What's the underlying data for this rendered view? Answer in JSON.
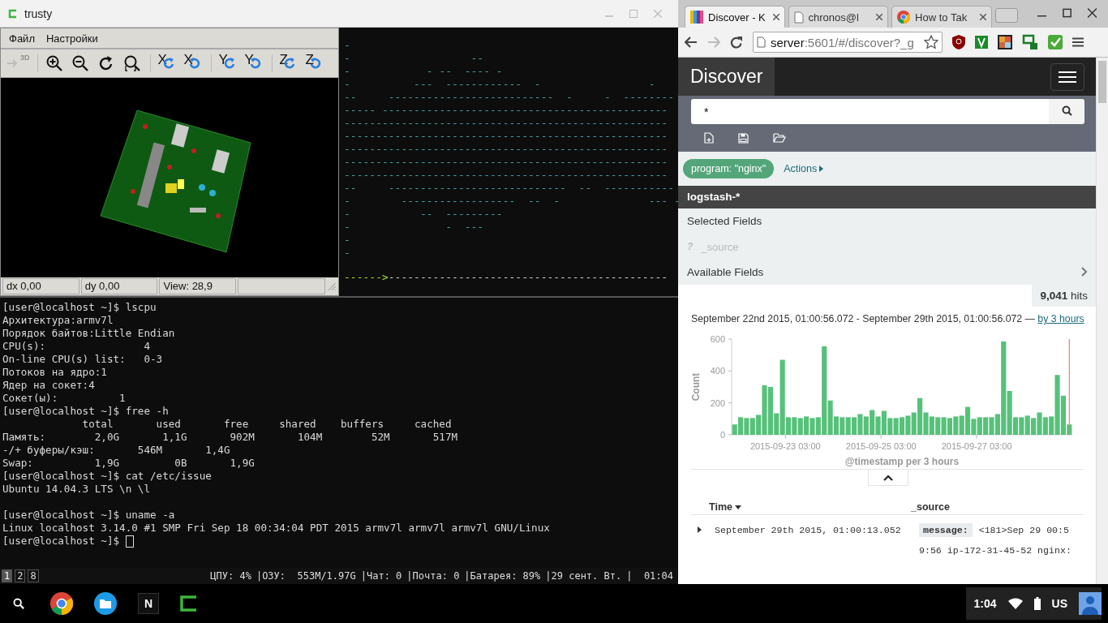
{
  "left_window": {
    "title": "trusty"
  },
  "app": {
    "menu": [
      "Файл",
      "Настройки"
    ],
    "toolbar": [
      {
        "kind": "perspective",
        "label": "3D",
        "disabled": true
      },
      {
        "kind": "zoomin",
        "disabled": false
      },
      {
        "kind": "zoomout",
        "disabled": false
      },
      {
        "kind": "redraw",
        "disabled": false
      },
      {
        "kind": "zoomfit",
        "disabled": false
      },
      {
        "kind": "rotateleft",
        "axis": "X",
        "disabled": false
      },
      {
        "kind": "rotateright",
        "axis": "X",
        "disabled": false
      },
      {
        "kind": "rotateleft",
        "axis": "Y",
        "disabled": false
      },
      {
        "kind": "rotateright",
        "axis": "Y",
        "disabled": false
      },
      {
        "kind": "rotateleft",
        "axis": "Z",
        "disabled": false
      },
      {
        "kind": "rotateright",
        "axis": "Z",
        "disabled": false
      }
    ],
    "status": [
      "dx 0,00",
      "dy 0,00",
      "View: 28,9"
    ]
  },
  "ascii": {
    "lines": [
      "-",
      "-                   --",
      "-            - --  ---- -",
      "-          ---  ------------  -                 -",
      "--     --------------------------  -     -  --------",
      "----- ---------------------------------------------",
      "---------------------------------------------------",
      "---------------------------------------------------",
      "---------------------------------------------------",
      "---------------------------------------------------",
      "---------------------------------------------------",
      "--     ----------------------------  --  -----------",
      "-        ------------------  --  -              --- -",
      "-           --  ---------",
      "-               -  ---",
      "-",
      "-"
    ],
    "progress": {
      "done": "------>",
      "rest": "--------------------------------------------"
    }
  },
  "terminal": {
    "lines": [
      {
        "kind": "text",
        "text": "[user@localhost ~]$ lscpu"
      },
      {
        "kind": "text",
        "text": "Архитектура:armv7l"
      },
      {
        "kind": "text",
        "text": "Порядок байтов:Little Endian"
      },
      {
        "kind": "text",
        "text": "CPU(s):                4"
      },
      {
        "kind": "text",
        "text": "On-line CPU(s) list:   0-3"
      },
      {
        "kind": "text",
        "text": "Потоков на ядро:1"
      },
      {
        "kind": "text",
        "text": "Ядер на сокет:4"
      },
      {
        "kind": "text",
        "text": "Сокет(ы):          1"
      },
      {
        "kind": "text",
        "text": "[user@localhost ~]$ free -h"
      },
      {
        "kind": "text",
        "text": "             total       used       free     shared    buffers     cached"
      },
      {
        "kind": "text",
        "text": "Память:        2,0G       1,1G       902M       104M        52M       517M"
      },
      {
        "kind": "text",
        "text": "-/+ буферы/кэш:       546M       1,4G"
      },
      {
        "kind": "text",
        "text": "Swap:          1,9G         0B       1,9G"
      },
      {
        "kind": "text",
        "text": "[user@localhost ~]$ cat /etc/issue"
      },
      {
        "kind": "text",
        "text": "Ubuntu 14.04.3 LTS \\n \\l"
      },
      {
        "kind": "blank"
      },
      {
        "kind": "text",
        "text": "[user@localhost ~]$ uname -a"
      },
      {
        "kind": "text",
        "text": "Linux localhost 3.14.0 #1 SMP Fri Sep 18 00:34:04 PDT 2015 armv7l armv7l armv7l GNU/Linux"
      }
    ],
    "prompt": "[user@localhost ~]$"
  },
  "tmux": {
    "windows": [
      {
        "label": "1",
        "selected": true
      },
      {
        "label": "2",
        "selected": false
      },
      {
        "label": "8",
        "selected": false
      }
    ],
    "segments": [
      "ЦПУ: 4%",
      "|ОЗУ:  553M/1.97G",
      "|Чат: 0",
      "|Почта: 0",
      "|Батарея: 89%",
      "|29 сент. Вт.",
      "|  01:04"
    ]
  },
  "browser": {
    "tabs": [
      {
        "title": "Discover - K",
        "kind": "kibana",
        "selected": true
      },
      {
        "title": "chronos@l",
        "kind": "page",
        "selected": false
      },
      {
        "title": "How to Tak",
        "kind": "chrome",
        "selected": false
      }
    ],
    "back_disabled": false,
    "forward_disabled": true,
    "url": {
      "host": "server",
      "rest": ":5601/#/discover?_g"
    },
    "extensions": [
      {
        "kind": "shield"
      },
      {
        "kind": "v"
      },
      {
        "kind": "s"
      },
      {
        "kind": "screens"
      },
      {
        "kind": "check"
      }
    ]
  },
  "kibana": {
    "title": "Discover",
    "query": "*",
    "filter": "program: \"nginx\"",
    "actions": "Actions",
    "index": "logstash-*",
    "selected_heading": "Selected Fields",
    "selected_fields": [
      {
        "type": "?",
        "name": "_source"
      }
    ],
    "available_heading": "Available Fields",
    "hits": {
      "count": "9,041",
      "label": "hits"
    },
    "range": "September 22nd 2015, 01:00:56.072 - September 29th 2015, 01:00:56.072 —",
    "interval": "by 3 hours",
    "chart_data": {
      "type": "bar",
      "xlabel": "@timestamp per 3 hours",
      "ylabel": "Count",
      "categories": [
        null,
        null,
        null,
        null,
        null,
        null,
        null,
        null,
        null,
        "2015-09-23 03:00",
        null,
        null,
        null,
        null,
        null,
        null,
        null,
        null,
        null,
        null,
        null,
        null,
        null,
        null,
        null,
        "2015-09-25 03:00",
        null,
        null,
        null,
        null,
        null,
        null,
        null,
        null,
        null,
        null,
        null,
        null,
        null,
        null,
        null,
        "2015-09-27 03:00",
        null,
        null,
        null,
        null,
        null,
        null,
        null,
        null,
        null,
        null,
        null,
        null,
        null,
        null,
        null
      ],
      "series": [
        {
          "color": "#57c17b",
          "values": [
            65,
            110,
            105,
            105,
            125,
            310,
            300,
            135,
            470,
            110,
            110,
            105,
            115,
            105,
            110,
            555,
            215,
            115,
            110,
            110,
            110,
            130,
            115,
            155,
            115,
            150,
            105,
            105,
            110,
            120,
            140,
            230,
            140,
            115,
            110,
            110,
            105,
            115,
            120,
            175,
            100,
            110,
            110,
            110,
            130,
            585,
            275,
            110,
            110,
            120,
            105,
            140,
            110,
            115,
            375,
            245,
            65
          ]
        }
      ],
      "ylim": [
        0,
        600
      ],
      "yticks": [
        0,
        200,
        400,
        600
      ]
    },
    "columns": [
      "Time",
      "_source"
    ],
    "rows": [
      {
        "time": "September 29th 2015, 01:00:13.052",
        "field": "message:",
        "value_lines": [
          "<181>Sep 29 00:5",
          "9:56 ip-172-31-45-52 nginx:"
        ]
      }
    ]
  },
  "taskbar": {
    "apps": [
      {
        "kind": "chrome"
      },
      {
        "kind": "files"
      },
      {
        "kind": "notes",
        "label": "N"
      },
      {
        "kind": "terminal"
      }
    ],
    "clock": "1:04",
    "lang": "US"
  }
}
